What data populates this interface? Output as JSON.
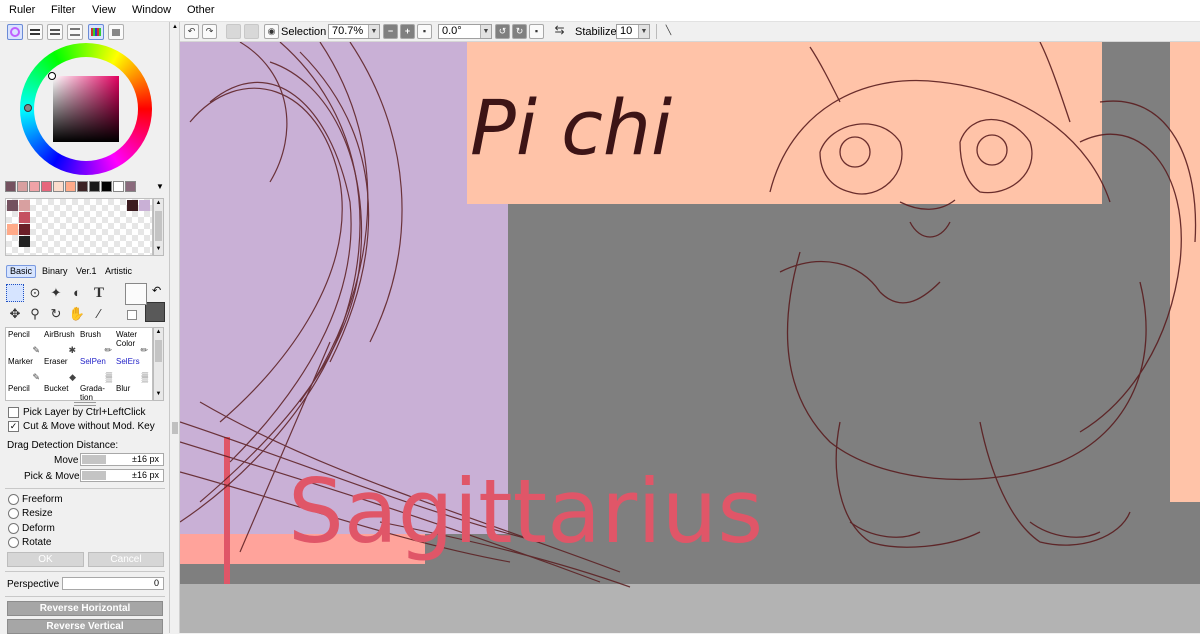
{
  "menu": [
    "Ruler",
    "Filter",
    "View",
    "Window",
    "Other"
  ],
  "toolbar": {
    "selection_label": "Selection",
    "zoom": "70.7%",
    "rotation": "0.0°",
    "stabilizer_label": "Stabilizer",
    "stabilizer_value": "10"
  },
  "palette_row": [
    "#74515f",
    "#d8a0a0",
    "#f0a3a7",
    "#e6667c",
    "#fbdccc",
    "#ffaa89",
    "#3c2224",
    "#1a1a1a",
    "#000000",
    "#ffffff",
    "#8a6a7c"
  ],
  "tool_tabs": [
    "Basic",
    "Binary",
    "Ver.1",
    "Artistic"
  ],
  "brushes": [
    {
      "name": "Pencil",
      "icon": "pencil-icon",
      "glyph": "✎",
      "color": "#000000"
    },
    {
      "name": "AirBrush",
      "icon": "airbrush-icon",
      "glyph": "✱",
      "color": "#000000"
    },
    {
      "name": "Brush",
      "icon": "brush-icon",
      "glyph": "✏",
      "color": "#000000"
    },
    {
      "name": "Water Color",
      "icon": "watercolor-icon",
      "glyph": "✏",
      "color": "#000000"
    },
    {
      "name": "Marker",
      "icon": "marker-icon",
      "glyph": "✎",
      "color": "#000000"
    },
    {
      "name": "Eraser",
      "icon": "eraser-icon",
      "glyph": "◆",
      "color": "#000000"
    },
    {
      "name": "SelPen",
      "icon": "selpen-icon",
      "glyph": "▒",
      "color": "#2323c8"
    },
    {
      "name": "SelErs",
      "icon": "selers-icon",
      "glyph": "▒",
      "color": "#2323c8"
    },
    {
      "name": "Pencil",
      "icon": "pencil-icon",
      "glyph": "✎",
      "color": "#000000"
    },
    {
      "name": "Bucket",
      "icon": "bucket-icon",
      "glyph": "◆",
      "color": "#000000"
    },
    {
      "name": "Grada-tion",
      "icon": "gradation-icon",
      "glyph": "▄",
      "color": "#000000"
    },
    {
      "name": "Blur",
      "icon": "blur-icon",
      "glyph": "•",
      "color": "#000000"
    }
  ],
  "options": {
    "pick_layer": "Pick Layer by Ctrl+LeftClick",
    "pick_layer_checked": false,
    "cut_move": "Cut & Move without Mod. Key",
    "cut_move_checked": true,
    "drag_detection": "Drag Detection Distance:",
    "move_label": "Move",
    "move_value": "±16 px",
    "pick_move_label": "Pick & Move",
    "pick_move_value": "±16 px"
  },
  "transform": [
    "Freeform",
    "Resize",
    "Deform",
    "Rotate"
  ],
  "ok_label": "OK",
  "cancel_label": "Cancel",
  "perspective_label": "Perspective",
  "perspective_value": "0",
  "reverse_horizontal": "Reverse Horizontal",
  "reverse_vertical": "Reverse Vertical",
  "canvas": {
    "title_text": "Pi chi",
    "subtitle_text": "Sagittarius",
    "colors": {
      "lavender": "#c9b0d6",
      "peach": "#ffc3a8",
      "gray": "#7f7f7f",
      "light_gray": "#b3b3b3",
      "pink_label": "#e05668",
      "sketch": "#5a1d1f",
      "title": "#3d1416"
    }
  }
}
